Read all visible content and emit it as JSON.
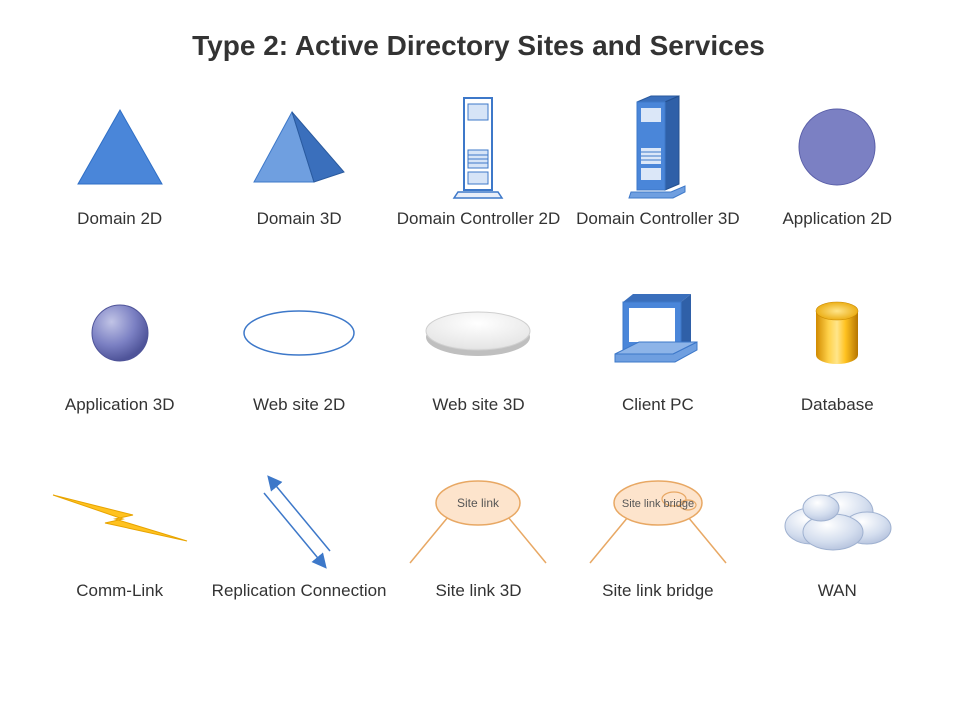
{
  "title": "Type 2: Active Directory Sites and Services",
  "items": [
    {
      "label": "Domain 2D"
    },
    {
      "label": "Domain 3D"
    },
    {
      "label": "Domain Controller 2D"
    },
    {
      "label": "Domain Controller 3D"
    },
    {
      "label": "Application 2D"
    },
    {
      "label": "Application 3D"
    },
    {
      "label": "Web site 2D"
    },
    {
      "label": "Web site 3D"
    },
    {
      "label": "Client PC"
    },
    {
      "label": "Database"
    },
    {
      "label": "Comm-Link"
    },
    {
      "label": "Replication Connection"
    },
    {
      "label": "Site link 3D"
    },
    {
      "label": "Site link bridge"
    },
    {
      "label": "WAN"
    }
  ],
  "inner_labels": {
    "site_link": "Site link",
    "site_link_bridge": "Site link bridge"
  }
}
